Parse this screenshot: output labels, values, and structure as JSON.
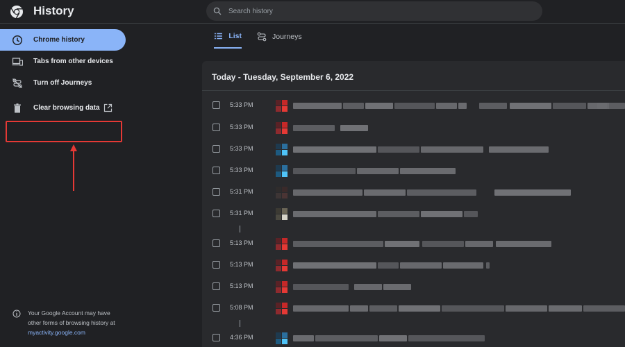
{
  "app": {
    "title": "History",
    "logo_icon": "chrome-logo-icon"
  },
  "search": {
    "placeholder": "Search history",
    "icon": "search-icon"
  },
  "sidebar": {
    "items": [
      {
        "label": "Chrome history",
        "icon": "clock-icon",
        "active": true
      },
      {
        "label": "Tabs from other devices",
        "icon": "devices-icon",
        "active": false
      },
      {
        "label": "Turn off Journeys",
        "icon": "journeys-off-icon",
        "active": false
      },
      {
        "label": "Clear browsing data",
        "icon": "trash-icon",
        "active": false,
        "external_icon": "external-link-icon"
      }
    ],
    "footer": {
      "text": "Your Google Account may have other forms of browsing history at",
      "link": "myactivity.google.com"
    }
  },
  "tabs": [
    {
      "label": "List",
      "icon": "list-icon",
      "active": true
    },
    {
      "label": "Journeys",
      "icon": "journeys-icon",
      "active": false
    }
  ],
  "history": {
    "date_header": "Today - Tuesday, September 6, 2022",
    "entries": [
      {
        "time": "5:33 PM",
        "favicon": "youtube-favicon"
      },
      {
        "time": "5:33 PM",
        "favicon": "youtube-favicon"
      },
      {
        "time": "5:33 PM",
        "favicon": "blue-favicon"
      },
      {
        "time": "5:33 PM",
        "favicon": "blue-favicon"
      },
      {
        "time": "5:31 PM",
        "favicon": "dark-favicon"
      },
      {
        "time": "5:31 PM",
        "favicon": "gray-favicon"
      },
      {
        "time": "5:13 PM",
        "favicon": "youtube-favicon"
      },
      {
        "time": "5:13 PM",
        "favicon": "youtube-favicon"
      },
      {
        "time": "5:13 PM",
        "favicon": "youtube-favicon"
      },
      {
        "time": "5:08 PM",
        "favicon": "youtube-favicon"
      },
      {
        "time": "4:36 PM",
        "favicon": "blue-favicon"
      }
    ]
  },
  "colors": {
    "accent": "#8ab4f8",
    "background": "#202124",
    "card": "#292a2d",
    "highlight": "#e53935"
  }
}
